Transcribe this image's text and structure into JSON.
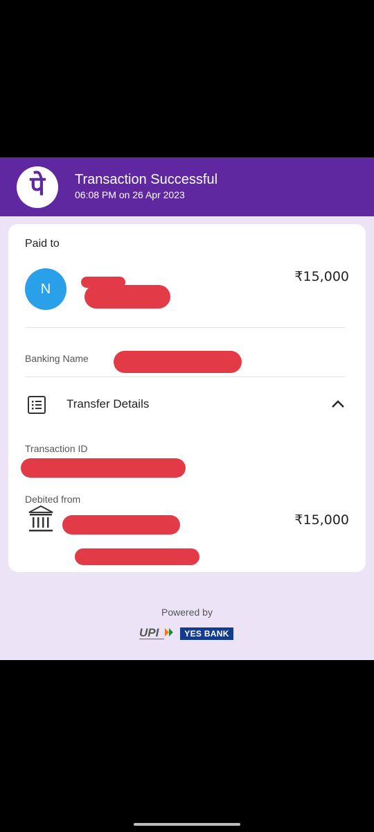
{
  "header": {
    "logo_glyph": "पे",
    "title": "Transaction Successful",
    "subtitle": "06:08 PM on 26 Apr 2023",
    "background": "#5f27a0"
  },
  "paid_to": {
    "label": "Paid to",
    "avatar_initial": "N",
    "avatar_color": "#29a0e8",
    "amount": "₹15,000"
  },
  "banking": {
    "label": "Banking Name"
  },
  "transfer_details": {
    "title": "Transfer Details",
    "icon": "list-icon",
    "toggle_icon": "chevron-up-icon",
    "transaction_id_label": "Transaction ID",
    "debited_from_label": "Debited from",
    "bank_icon": "bank-icon",
    "debited_amount": "₹15,000"
  },
  "footer": {
    "powered_by": "Powered by",
    "upi_logo": "UPI",
    "bank_logo": "YES BANK"
  },
  "redaction_color": "#e33a48"
}
